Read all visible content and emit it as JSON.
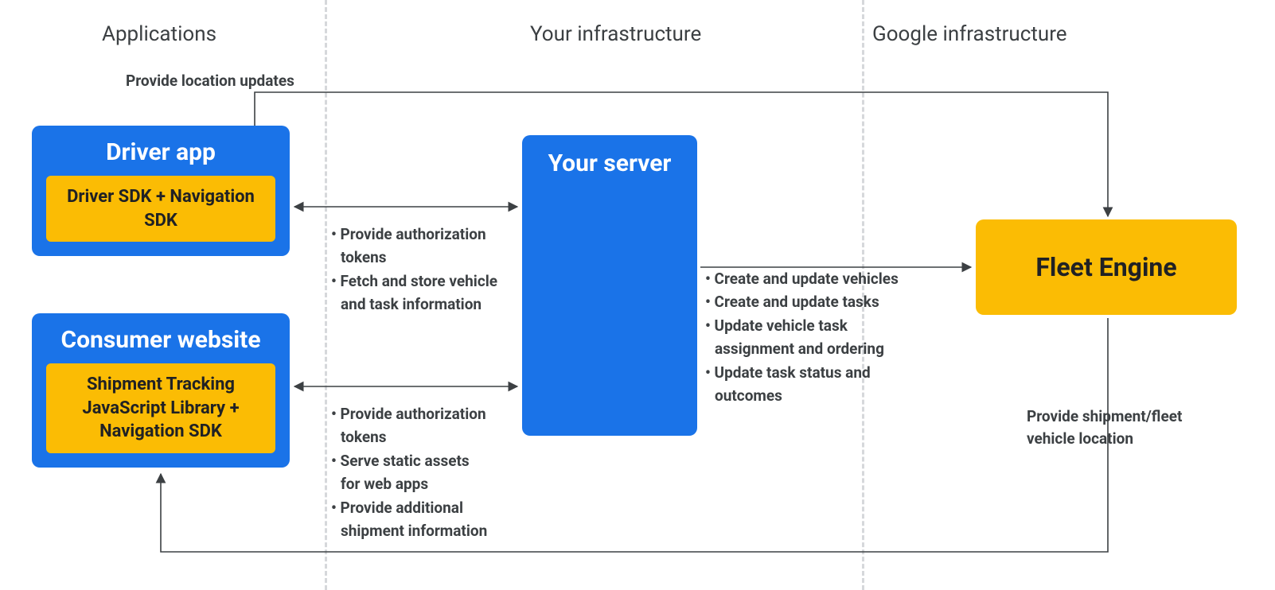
{
  "sections": {
    "applications": "Applications",
    "your_infra": "Your infrastructure",
    "google_infra": "Google infrastructure"
  },
  "driver": {
    "title": "Driver app",
    "chip": "Driver SDK + Navigation SDK"
  },
  "consumer": {
    "title": "Consumer website",
    "chip": "Shipment Tracking JavaScript Library  + Navigation SDK"
  },
  "server": {
    "title": "Your server"
  },
  "fleet": {
    "title": "Fleet Engine"
  },
  "labels": {
    "top": "Provide location updates",
    "bottom": "Provide shipment/fleet vehicle location"
  },
  "arrow_notes": {
    "driver_server_0": "• Provide authorization",
    "driver_server_1": "  tokens",
    "driver_server_2": "• Fetch and store vehicle",
    "driver_server_3": "  and task information",
    "consumer_server_0": "• Provide authorization",
    "consumer_server_1": "  tokens",
    "consumer_server_2": "• Serve static assets",
    "consumer_server_3": "  for web apps",
    "consumer_server_4": "• Provide additional",
    "consumer_server_5": "  shipment information",
    "server_fleet_0": "• Create and update vehicles",
    "server_fleet_1": "• Create and update tasks",
    "server_fleet_2": "• Update vehicle task",
    "server_fleet_3": "  assignment and ordering",
    "server_fleet_4": "• Update task status and",
    "server_fleet_5": "  outcomes"
  },
  "chart_data": {
    "type": "diagram",
    "sections": [
      {
        "name": "Applications",
        "contains": [
          "Driver app",
          "Consumer website"
        ]
      },
      {
        "name": "Your infrastructure",
        "contains": [
          "Your server"
        ]
      },
      {
        "name": "Google infrastructure",
        "contains": [
          "Fleet Engine"
        ]
      }
    ],
    "nodes": [
      {
        "id": "driver_app",
        "label": "Driver app",
        "chip": "Driver SDK + Navigation SDK",
        "section": "Applications"
      },
      {
        "id": "consumer_website",
        "label": "Consumer website",
        "chip": "Shipment Tracking JavaScript Library + Navigation SDK",
        "section": "Applications"
      },
      {
        "id": "your_server",
        "label": "Your server",
        "section": "Your infrastructure"
      },
      {
        "id": "fleet_engine",
        "label": "Fleet Engine",
        "section": "Google infrastructure"
      }
    ],
    "edges": [
      {
        "from": "driver_app",
        "to": "your_server",
        "direction": "both",
        "notes": [
          "Provide authorization tokens",
          "Fetch and store vehicle and task information"
        ]
      },
      {
        "from": "consumer_website",
        "to": "your_server",
        "direction": "both",
        "notes": [
          "Provide authorization tokens",
          "Serve static assets for web apps",
          "Provide additional shipment information"
        ]
      },
      {
        "from": "your_server",
        "to": "fleet_engine",
        "direction": "forward",
        "notes": [
          "Create and update vehicles",
          "Create and update tasks",
          "Update vehicle task assignment and ordering",
          "Update task status and outcomes"
        ]
      },
      {
        "from": "driver_app",
        "to": "fleet_engine",
        "direction": "forward",
        "label": "Provide location updates",
        "path": "top"
      },
      {
        "from": "fleet_engine",
        "to": "consumer_website",
        "direction": "forward",
        "label": "Provide shipment/fleet vehicle location",
        "path": "bottom"
      }
    ]
  }
}
